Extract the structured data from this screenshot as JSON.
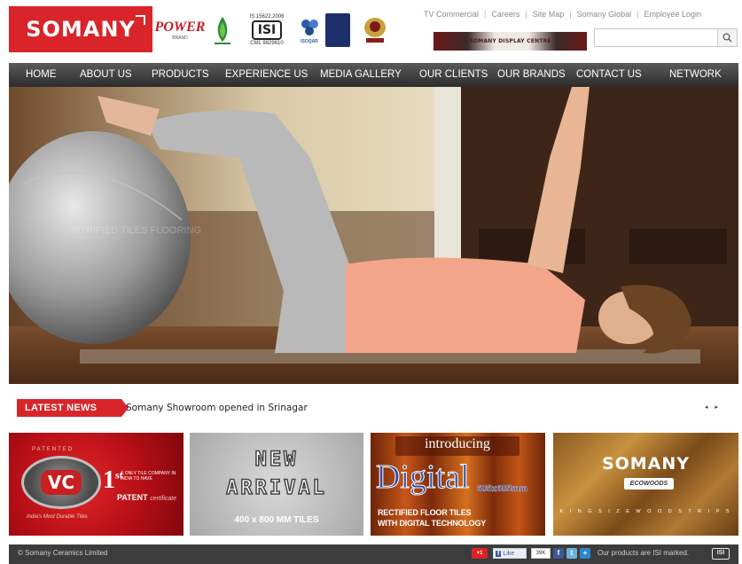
{
  "header": {
    "logo_text": "SOMANY",
    "badges": {
      "power_brand": "POWER",
      "power_brand_sub": "BRAND",
      "isi_standard": "IS:15622:2006",
      "isi_mark": "ISI",
      "isi_cml": "CML 9829610",
      "isoqar": "ISOQAR"
    },
    "top_links": [
      "TV Commercial",
      "Careers",
      "Site Map",
      "Somany Global",
      "Employee Login"
    ],
    "display_centre_label": "SOMANY DISPLAY CENTRE",
    "search": {
      "placeholder": "",
      "value": "",
      "icon": "search-icon"
    }
  },
  "nav": {
    "items": [
      "HOME",
      "ABOUT US",
      "PRODUCTS",
      "EXPERIENCE US",
      "MEDIA GALLERY",
      "OUR CLIENTS",
      "OUR BRANDS",
      "CONTACT US",
      "NETWORK"
    ]
  },
  "banner": {
    "subject": "woman exercising on mat with fitness ball",
    "watermark": "VITRIFIED TILES FLOORING"
  },
  "news": {
    "badge": "LATEST NEWS",
    "headline": "Somany Showroom opened in Srinagar",
    "controls": "◂ ▸"
  },
  "promos": [
    {
      "patented": "PATENTED",
      "logo": "VC",
      "first": "1",
      "first_sup": "st",
      "small": "& ONLY TILE COMPANY IN INDIA TO HAVE",
      "patent": "PATENT",
      "certificate": "certificate",
      "tagline": "India's Most Durable Tiles"
    },
    {
      "line1": "NEW",
      "line2": "ARRIVAL",
      "size": "400 x 800 MM TILES"
    },
    {
      "intro": "introducing",
      "digital": "Digital",
      "dimension": "605x605mm",
      "line1": "RECTIFIED FLOOR TILES",
      "line2": "WITH DIGITAL TECHNOLOGY"
    },
    {
      "brand": "SOMANY",
      "sub": "ECOWOODS",
      "tagline": "K I N G   S I Z E   W O O D   S T R I P S"
    }
  ],
  "footer": {
    "copyright": "© Somany Ceramics Limited",
    "gplus": "+1",
    "fb_like": "Like",
    "fb_count": "39K",
    "isi_note": "Our products are ISI marked.",
    "isi_mark": "ISI"
  },
  "colors": {
    "brand_red": "#d9252a",
    "nav_dark": "#2c2c2c",
    "footer_dark": "#3c3c3c"
  }
}
